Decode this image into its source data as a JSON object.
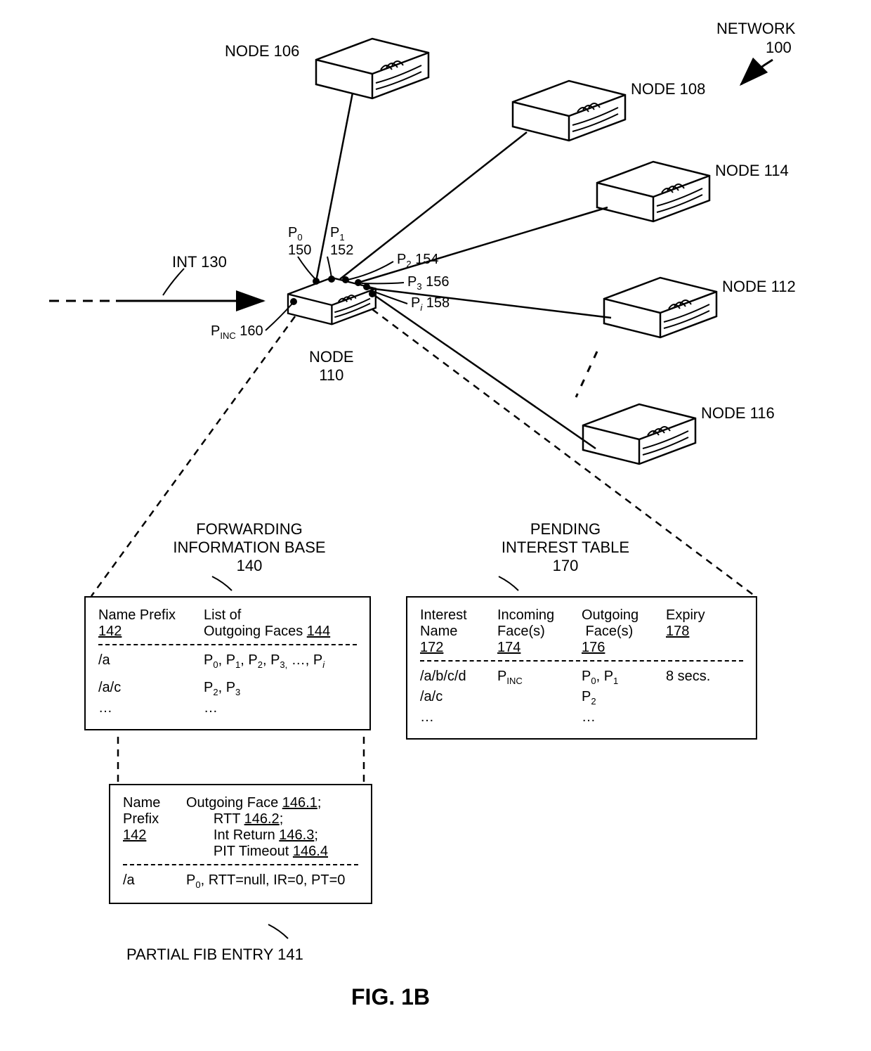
{
  "chart_data": null,
  "figure_title": "FIG. 1B",
  "network_label": "NETWORK",
  "network_ref": "100",
  "int_label": "INT 130",
  "nodes": {
    "center": {
      "label": "NODE",
      "ref": "110"
    },
    "n106": "NODE 106",
    "n108": "NODE 108",
    "n114": "NODE 114",
    "n112": "NODE 112",
    "n116": "NODE 116"
  },
  "ports": {
    "p0": {
      "sym": "P",
      "sub": "0",
      "ref": "150"
    },
    "p1": {
      "sym": "P",
      "sub": "1",
      "ref": "152"
    },
    "p2": {
      "sym": "P",
      "sub": "2",
      "ref": "154"
    },
    "p3": {
      "sym": "P",
      "sub": "3",
      "ref": "156"
    },
    "pi": {
      "sym": "P",
      "sub": "i",
      "ref": "158"
    },
    "pinc": {
      "sym": "P",
      "sub": "INC",
      "ref": "160"
    }
  },
  "fib": {
    "title1": "FORWARDING",
    "title2": "INFORMATION BASE",
    "ref": "140",
    "col1_label": "Name Prefix",
    "col1_ref": "142",
    "col2_label1": "List of",
    "col2_label2": "Outgoing Faces",
    "col2_ref": "144",
    "rows": [
      {
        "prefix": "/a",
        "faces": "P₀, P₁, P₂, P₃, …, Pᵢ"
      },
      {
        "prefix": "/a/c",
        "faces": "P₂, P₃"
      },
      {
        "prefix": "…",
        "faces": "…"
      }
    ]
  },
  "pit": {
    "title1": "PENDING",
    "title2": "INTEREST TABLE",
    "ref": "170",
    "col1_label": "Interest Name",
    "col1_ref": "172",
    "col2_label": "Incoming Face(s)",
    "col2_ref": "174",
    "col3_label": "Outgoing  Face(s)",
    "col3_ref": "176",
    "col4_label": "Expiry",
    "col4_ref": "178",
    "rows": [
      {
        "name": "/a/b/c/d",
        "in": "PINC",
        "out": "P₀, P₁",
        "exp": "8 secs."
      },
      {
        "name": "/a/c",
        "in": "",
        "out": "P₂",
        "exp": ""
      },
      {
        "name": "…",
        "in": "",
        "out": "…",
        "exp": ""
      }
    ]
  },
  "partial": {
    "label": "PARTIAL FIB ENTRY 141",
    "col1": "Name Prefix",
    "col1_ref_u": "142",
    "attr1": "Outgoing Face",
    "attr1_ref": "146.1",
    "attr2": "RTT",
    "attr2_ref": "146.2",
    "attr3": "Int Return",
    "attr3_ref": "146.3",
    "attr4": "PIT Timeout",
    "attr4_ref": "146.4",
    "row_prefix": "/a",
    "row_data": "P₀, RTT=null, IR=0, PT=0"
  }
}
